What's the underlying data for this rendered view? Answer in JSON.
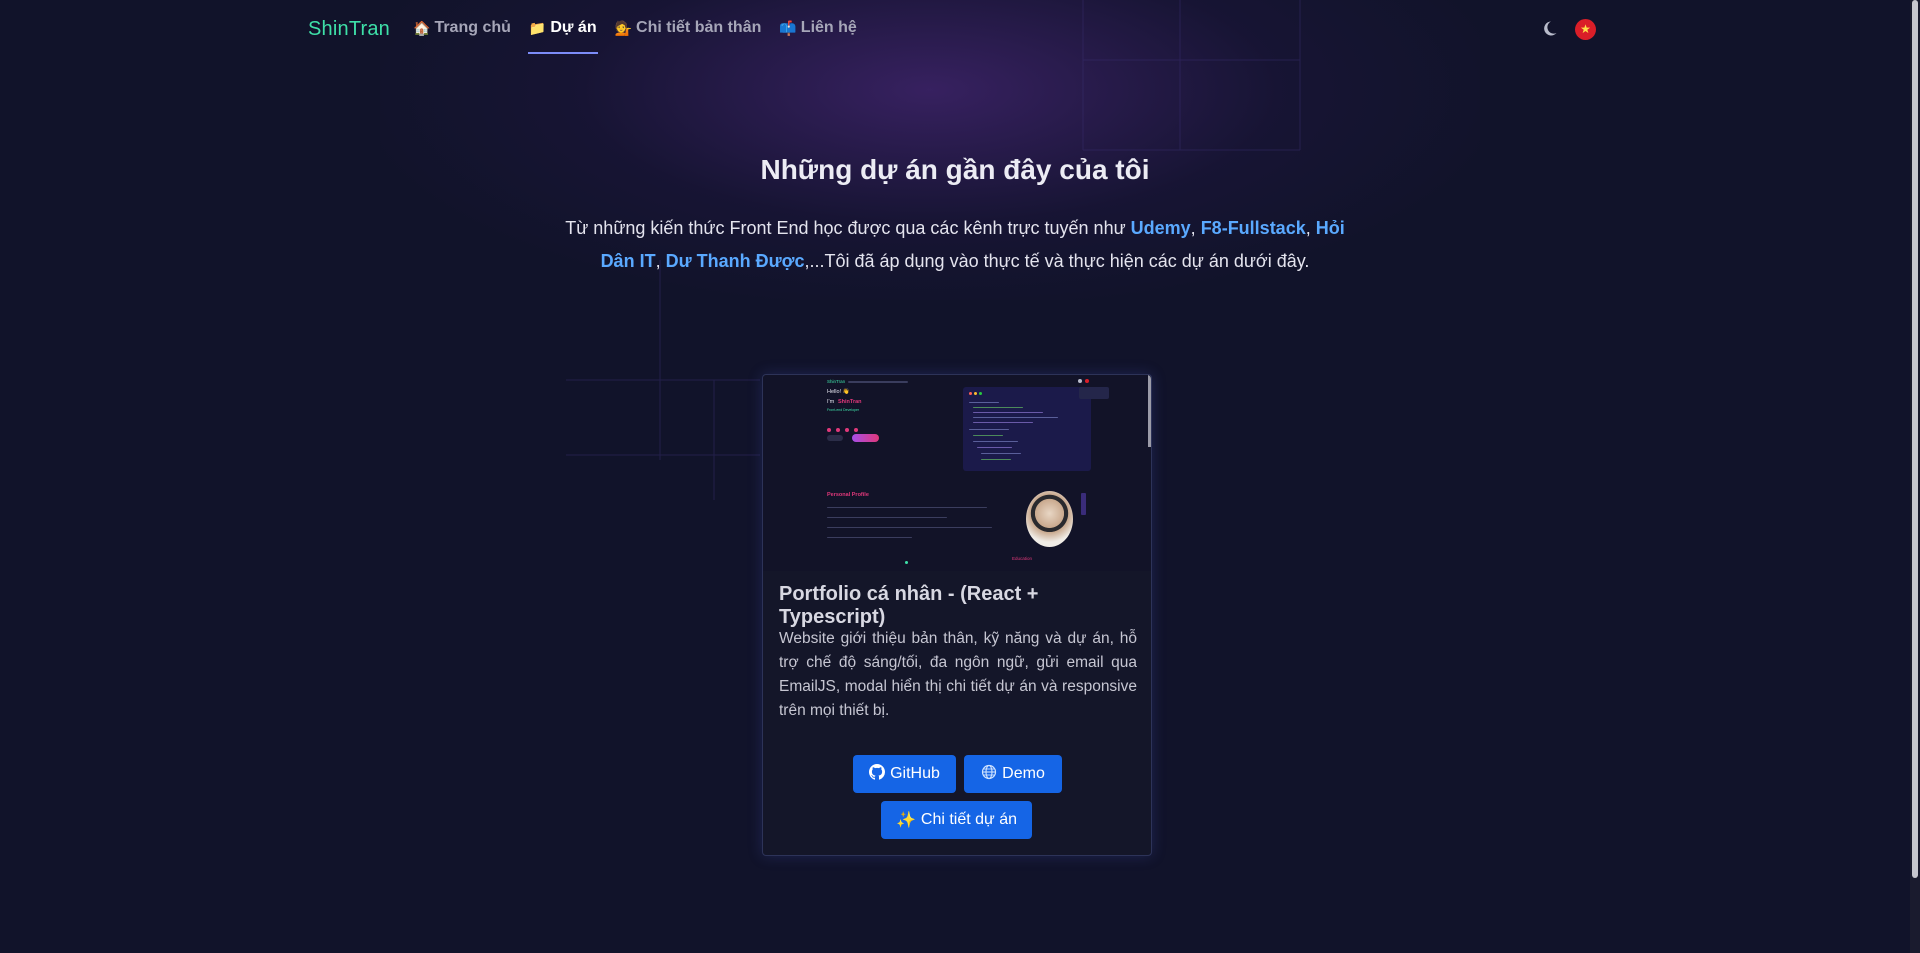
{
  "nav": {
    "brand": "ShinTran",
    "links": [
      {
        "emoji": "🏠",
        "label": "Trang chủ"
      },
      {
        "emoji": "📁",
        "label": "Dự án"
      },
      {
        "emoji": "💁",
        "label": "Chi tiết bản thân"
      },
      {
        "emoji": "📫",
        "label": "Liên hệ"
      }
    ],
    "active_index": 1,
    "theme_icon": "moon-icon",
    "lang_icon": "vietnam-flag-icon",
    "lang_flag_glyph": "★"
  },
  "section": {
    "title": "Những dự án gần đây của tôi",
    "intro_prefix": "Từ những kiến thức Front End học được qua các kênh trực tuyến như ",
    "sources": [
      "Udemy",
      "F8-Fullstack",
      "Hỏi Dân IT",
      "Dư Thanh Được"
    ],
    "separator": ", ",
    "intro_suffix": ",...Tôi đã áp dụng vào thực tế và thực hiện các dự án dưới đây."
  },
  "project": {
    "title": "Portfolio cá nhân - (React + Typescript)",
    "description": "Website giới thiệu bản thân, kỹ năng và dự án, hỗ trợ chế độ sáng/tối, đa ngôn ngữ, gửi email qua EmailJS, modal hiển thị chi tiết dự án và responsive trên mọi thiết bị.",
    "github_label": "GitHub",
    "demo_label": "Demo",
    "detail_label": "Chi tiết dự án",
    "detail_emoji": "✨",
    "github_icon": "github-icon",
    "demo_icon": "globe-icon",
    "thumbnail": {
      "brand": "ShinTran",
      "hello": "Hello! 👋",
      "name_prefix": "I'm",
      "name": "ShinTran",
      "role": "Front-end Developer",
      "profile_heading": "Personal Profile",
      "education_label": "Education"
    }
  },
  "colors": {
    "background": "#11132a",
    "brand": "#3ee0a8",
    "link_highlight": "#5aa9ff",
    "button": "#1565e6",
    "active_underline": "#7c8cf8",
    "thumb_accent": "#e0387a"
  }
}
